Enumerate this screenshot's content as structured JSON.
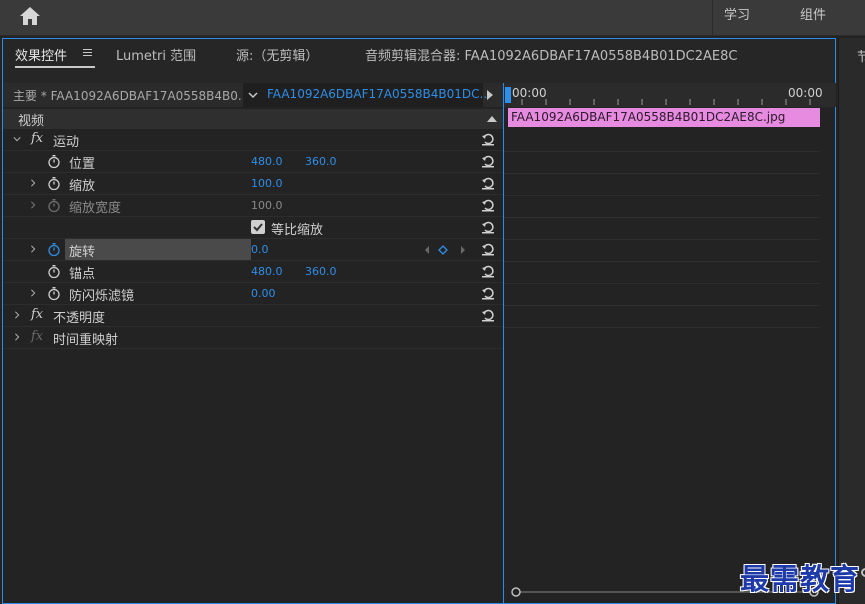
{
  "workspaces": {
    "learn": "学习",
    "components": "组件"
  },
  "tabs": [
    {
      "label": "效果控件"
    },
    {
      "label": "Lumetri 范围"
    },
    {
      "label": "源:（无剪辑）"
    },
    {
      "label": "音频剪辑混合器: FAA1092A6DBAF17A0558B4B01DC2AE8C"
    }
  ],
  "source": {
    "master": "主要 * FAA1092A6DBAF17A0558B4B0...",
    "clip": "FAA1092A6DBAF17A0558B4B01DC..."
  },
  "section_label": "视频",
  "effects": {
    "motion": "运动",
    "position": {
      "label": "位置",
      "x": "480.0",
      "y": "360.0"
    },
    "scale": {
      "label": "缩放",
      "value": "100.0"
    },
    "scale_width": {
      "label": "缩放宽度",
      "value": "100.0"
    },
    "uniform_scale": {
      "label": "等比缩放"
    },
    "rotation": {
      "label": "旋转",
      "value": "0.0"
    },
    "anchor": {
      "label": "锚点",
      "x": "480.0",
      "y": "360.0"
    },
    "flicker": {
      "label": "防闪烁滤镜",
      "value": "0.00"
    },
    "opacity": "不透明度",
    "time_remap": "时间重映射"
  },
  "fx_glyph": "fx",
  "timeline": {
    "start_tc": "00:00",
    "end_tc": "00:00",
    "clip_name": "FAA1092A6DBAF17A0558B4B01DC2AE8C.jpg"
  },
  "right_strip_label": "节",
  "watermark": "最需教育",
  "colors": {
    "accent": "#2f8ee8",
    "clip": "#e78be0",
    "panel_border": "#2d8ceb"
  },
  "icons": [
    "home-icon",
    "panel-menu-icon",
    "stopwatch-icon",
    "reset-icon",
    "twist-icon",
    "play-arrow-icon",
    "keyframe-nav-icon"
  ]
}
